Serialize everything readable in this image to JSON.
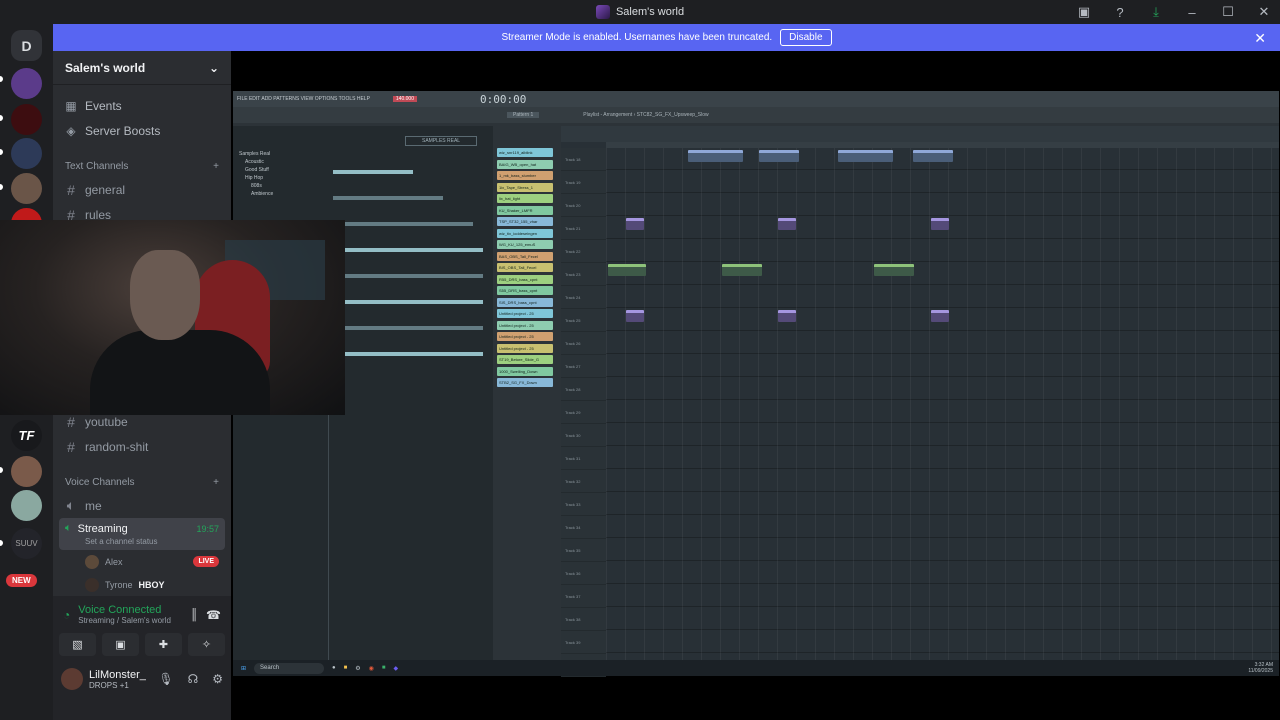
{
  "window": {
    "title": "Salem's world"
  },
  "banner": {
    "text": "Streamer Mode is enabled. Usernames have been truncated.",
    "button": "Disable"
  },
  "servers": {
    "new_badge": "NEW",
    "home_glyph": "D"
  },
  "guild": {
    "name": "Salem's world"
  },
  "nav": [
    {
      "label": "Events"
    },
    {
      "label": "Server Boosts"
    }
  ],
  "text_channels": {
    "title": "Text Channels",
    "items": [
      "general",
      "rules",
      "youtube",
      "random-shit"
    ]
  },
  "voice_channels": {
    "title": "Voice Channels",
    "items": [
      "me"
    ]
  },
  "voice_active": {
    "name": "Streaming",
    "time": "19:57",
    "status": "Set a channel status",
    "users": [
      {
        "name": "Alex",
        "badge": "LIVE"
      },
      {
        "name": "Tyrone",
        "tag": "HBOY"
      }
    ]
  },
  "voice_panel": {
    "connected": "Voice Connected",
    "location": "Streaming / Salem's world"
  },
  "user": {
    "name": "LilMonster_",
    "status": "DROPS",
    "extra": "+1"
  },
  "daw": {
    "menu": "FILE EDIT ADD PATTERNS VIEW OPTIONS TOOLS HELP",
    "time": "0:00:00",
    "bpm": "140.000",
    "pattern": "Pattern 1",
    "playlist_title": "Playlist - Arrangement › STC82_SG_FX_Upsweep_Slow",
    "browser_header": "SAMPLES REAL",
    "browser_tree": [
      "Samples Real",
      "Acoustic",
      "Good Stuff",
      "Hip Hop",
      "808s",
      "Ambience"
    ],
    "patterns": [
      "wiz_snr119_alblink",
      "BAIG_WB_open_hat",
      "1_mk_bass_slumber",
      "1ix_Tape_Stress_1",
      "lix_hat_light",
      "KU_Shaker_LMFR",
      "TSP_ST32_155_vhar",
      "wiz_tix_ioddeseingen",
      "WG_KU_125_emuS",
      "BAS_OBS_Tall_Fecel",
      "BIS_OBS_Tall_Fecel",
      "R55_DRS_bass_cpnt",
      "S55_DRS_bass_cpnt",
      "SIS_DRS_bass_cpnt",
      "Untitled project - 25",
      "Untitled project - 25",
      "Untitled project - 25",
      "Untitled project - 25",
      "ST19_Betore_Slide_G",
      "1000_Swelling_Down",
      "STB2_SG_FX_Down"
    ],
    "track_labels": [
      "Track 18",
      "Track 19",
      "Track 20",
      "Track 21",
      "Track 22",
      "Track 23",
      "Track 24",
      "Track 25",
      "Track 26",
      "Track 27",
      "Track 28",
      "Track 29",
      "Track 30",
      "Track 31",
      "Track 32",
      "Track 33",
      "Track 34",
      "Track 35",
      "Track 36",
      "Track 37",
      "Track 38",
      "Track 39",
      "Track 40"
    ],
    "taskbar_search": "Search",
    "clock_time": "3:32 AM",
    "clock_date": "11/09/2025"
  },
  "colors": {
    "accent": "#5865f2",
    "online": "#23a55a",
    "live": "#da373c",
    "sidebar": "#2b2d31",
    "rail": "#1e1f22"
  }
}
